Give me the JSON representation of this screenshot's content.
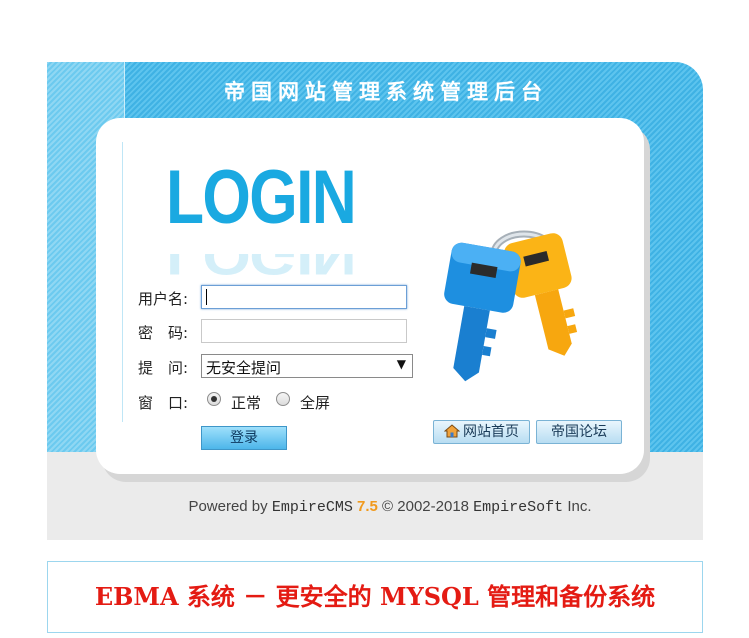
{
  "header": {
    "title": "帝国网站管理系统管理后台"
  },
  "logo": {
    "text": "LOGIN"
  },
  "form": {
    "username_label": "用户名:",
    "username_value": "",
    "password_label": "密　码:",
    "password_value": "",
    "question_label": "提　问:",
    "question_selected": "无安全提问",
    "window_label": "窗　口:",
    "window_options": [
      "正常",
      "全屏"
    ],
    "window_selected": "正常",
    "login_button": "登录"
  },
  "links": {
    "home": "网站首页",
    "forum": "帝国论坛"
  },
  "footer": {
    "powered_by": "Powered by",
    "brand": "EmpireCMS",
    "version": "7.5",
    "copyright": "© 2002-2018",
    "company": "EmpireSoft",
    "inc": "Inc."
  },
  "banner": {
    "text": "EBMA 系统 － 更安全的 MYSQL 管理和备份系统"
  },
  "colors": {
    "accent_blue": "#1aa9e1",
    "panel_blue": "#3fb2e4",
    "version_orange": "#f19a1d",
    "banner_red": "#e41b13"
  }
}
